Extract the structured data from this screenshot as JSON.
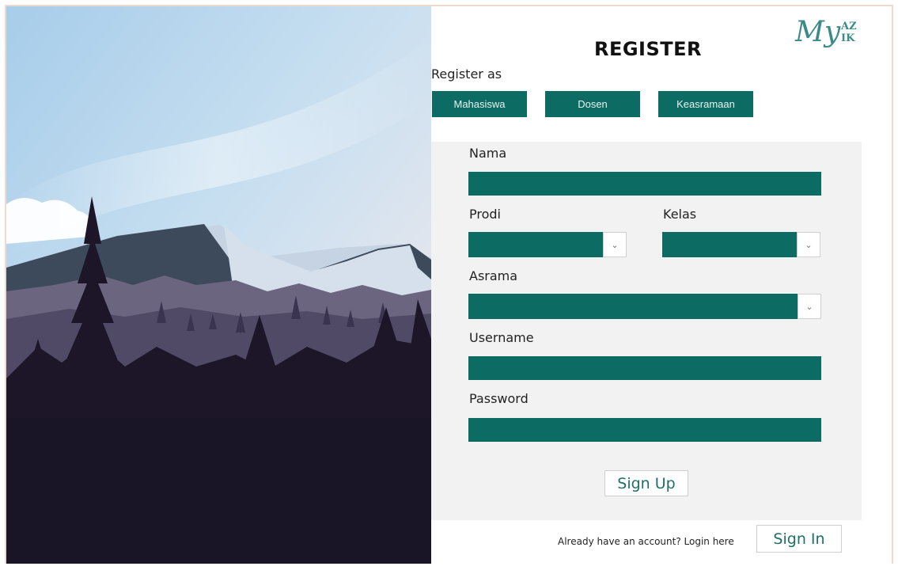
{
  "header": {
    "title": "REGISTER",
    "logo_text": "My",
    "logo_sub_top": "AZ",
    "logo_sub_bottom": "IK"
  },
  "register_as": {
    "label": "Register as",
    "options": [
      "Mahasiswa",
      "Dosen",
      "Keasramaan"
    ]
  },
  "form": {
    "nama_label": "Nama",
    "nama_value": "",
    "prodi_label": "Prodi",
    "prodi_value": "",
    "kelas_label": "Kelas",
    "kelas_value": "",
    "asrama_label": "Asrama",
    "asrama_value": "",
    "username_label": "Username",
    "username_value": "",
    "password_label": "Password",
    "password_value": "",
    "signup_label": "Sign Up"
  },
  "footer": {
    "hint": "Already have an account? Login here",
    "signin_label": "Sign In"
  },
  "colors": {
    "accent": "#0c6b63",
    "panel_bg": "#f2f2f2",
    "logo": "#3a8a88"
  },
  "icons": {
    "dropdown": "chevron-down-icon"
  }
}
